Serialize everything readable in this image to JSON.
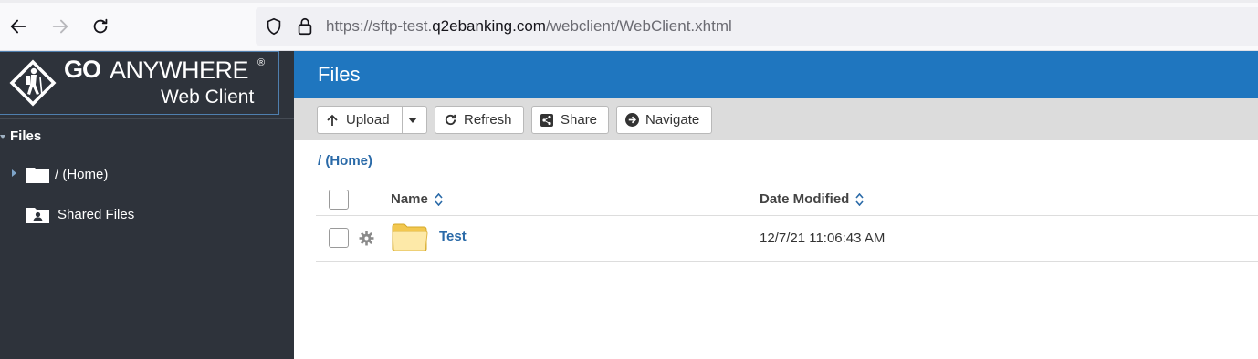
{
  "browser": {
    "url_prefix": "https://sftp-test.",
    "url_domain": "q2ebanking.com",
    "url_path": "/webclient/WebClient.xhtml"
  },
  "logo": {
    "go": "GO",
    "anywhere": "ANYWHERE",
    "reg": "®",
    "subtitle": "Web Client"
  },
  "sidebar": {
    "section": "Files",
    "items": [
      {
        "label": "/ (Home)",
        "icon": "folder-icon"
      },
      {
        "label": "Shared Files",
        "icon": "shared-folder-icon"
      }
    ]
  },
  "main": {
    "title": "Files",
    "toolbar": {
      "upload": "Upload",
      "refresh": "Refresh",
      "share": "Share",
      "navigate": "Navigate"
    },
    "breadcrumb": "/ (Home)",
    "columns": {
      "name": "Name",
      "date": "Date Modified"
    },
    "rows": [
      {
        "name": "Test",
        "date": "12/7/21 11:06:43 AM",
        "type": "folder"
      }
    ]
  },
  "colors": {
    "header_blue": "#1f76bf",
    "sidebar_bg": "#2e333b",
    "link_blue": "#2a6aa8",
    "toolbar_bg": "#dcdcdc"
  }
}
